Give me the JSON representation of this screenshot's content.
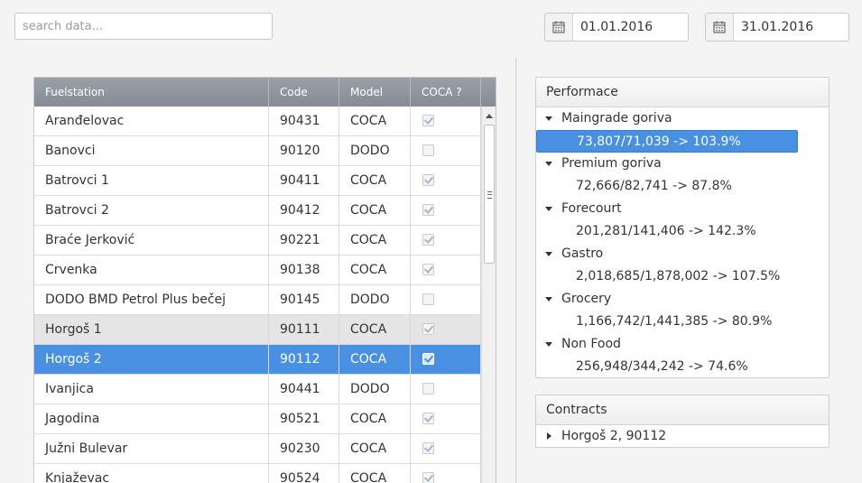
{
  "search": {
    "placeholder": "search data..."
  },
  "dates": {
    "from": "01.01.2016",
    "to": "31.01.2016"
  },
  "table": {
    "headers": [
      "Fuelstation",
      "Code",
      "Model",
      "COCA ?"
    ],
    "rows": [
      {
        "name": "Aranđelovac",
        "code": "90431",
        "model": "COCA",
        "coca": true
      },
      {
        "name": "Banovci",
        "code": "90120",
        "model": "DODO",
        "coca": false
      },
      {
        "name": "Batrovci 1",
        "code": "90411",
        "model": "COCA",
        "coca": true
      },
      {
        "name": "Batrovci 2",
        "code": "90412",
        "model": "COCA",
        "coca": true
      },
      {
        "name": "Braće Jerković",
        "code": "90221",
        "model": "COCA",
        "coca": true
      },
      {
        "name": "Crvenka",
        "code": "90138",
        "model": "COCA",
        "coca": true
      },
      {
        "name": "DODO BMD Petrol Plus bečej",
        "code": "90145",
        "model": "DODO",
        "coca": false
      },
      {
        "name": "Horgoš 1",
        "code": "90111",
        "model": "COCA",
        "coca": true
      },
      {
        "name": "Horgoš 2",
        "code": "90112",
        "model": "COCA",
        "coca": true
      },
      {
        "name": "Ivanjica",
        "code": "90441",
        "model": "DODO",
        "coca": false
      },
      {
        "name": "Jagodina",
        "code": "90521",
        "model": "COCA",
        "coca": true
      },
      {
        "name": "Južni Bulevar",
        "code": "90230",
        "model": "COCA",
        "coca": true
      },
      {
        "name": "Knjaževac",
        "code": "90524",
        "model": "COCA",
        "coca": true
      }
    ]
  },
  "performance": {
    "title": "Performace",
    "groups": [
      {
        "label": "Maingrade goriva",
        "value": "73,807/71,039 -> 103.9%"
      },
      {
        "label": "Premium goriva",
        "value": "72,666/82,741 -> 87.8%"
      },
      {
        "label": "Forecourt",
        "value": "201,281/141,406 -> 142.3%"
      },
      {
        "label": "Gastro",
        "value": "2,018,685/1,878,002 -> 107.5%"
      },
      {
        "label": "Grocery",
        "value": "1,166,742/1,441,385 -> 80.9%"
      },
      {
        "label": "Non Food",
        "value": "256,948/344,242 -> 74.6%"
      }
    ]
  },
  "contracts": {
    "title": "Contracts",
    "item": "Horgoš 2, 90112"
  }
}
